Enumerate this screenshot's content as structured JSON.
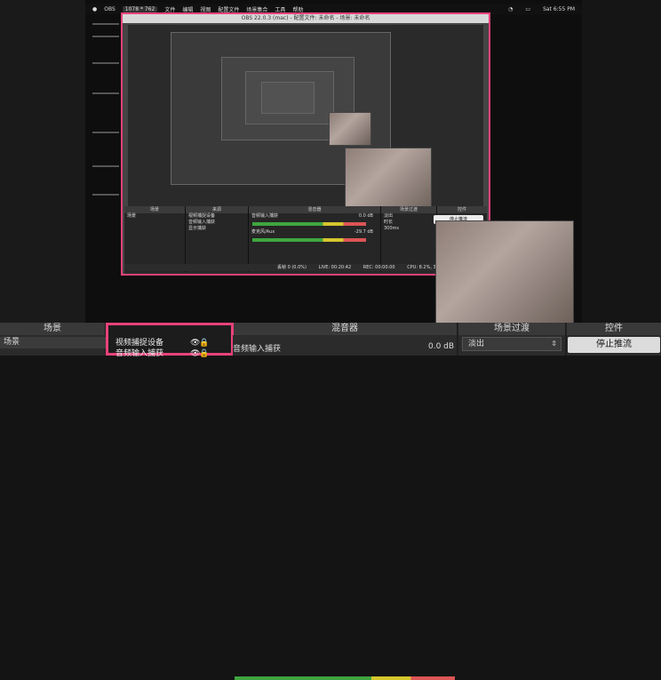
{
  "menubar": {
    "app": "OBS",
    "resolution": "1078 * 762",
    "items": [
      "文件",
      "编辑",
      "视图",
      "配置文件",
      "场景集合",
      "工具",
      "帮助"
    ],
    "right_time": "Sat 6:55 PM"
  },
  "inner_window": {
    "title": "OBS 22.0.3 (mac) - 配置文件: 未命名 - 场景: 未命名",
    "mini_panels": {
      "scenes": "场景",
      "sources": "来源",
      "mixer": "混音器",
      "transition": "场景过渡",
      "controls": "控件"
    },
    "mini_scene": "场景",
    "mini_sources": [
      "视频捕捉设备",
      "音频输入捕获",
      "显示捕获"
    ],
    "mini_mixer": [
      {
        "name": "音频输入捕获",
        "db": "0.0 dB"
      },
      {
        "name": "麦克风/Aux",
        "db": "-29.7 dB"
      }
    ],
    "mini_transition": "淡出",
    "mini_duration": "时长",
    "mini_duration_value": "300ms",
    "mini_stop": "停止推流",
    "status": {
      "dropped": "丢帧 0 (0.0%)",
      "live": "LIVE: 00:20:42",
      "rec": "REC: 00:00:00",
      "cpu": "CPU: 8.2%, 30.00 fps"
    }
  },
  "bottom": {
    "headers": {
      "scenes": "场景",
      "sources": "来源",
      "mixer": "混音器",
      "transition": "场景过渡",
      "controls": "控件"
    },
    "scene_item": "场景",
    "sources": [
      "视频捕捉设备",
      "音频输入捕获"
    ],
    "mixer_channel": "音频输入捕获",
    "mixer_db": "0.0 dB",
    "transition_value": "淡出",
    "stop_button": "停止推流"
  },
  "icons": [
    "eye-icon",
    "lock-icon",
    "chevron-updown-icon",
    "plus-icon",
    "minus-icon",
    "gear-icon"
  ],
  "colors": {
    "highlight": "#e8427c",
    "meter_green": "#3fa63f",
    "meter_yellow": "#d7c72d",
    "meter_red": "#dd5555"
  }
}
